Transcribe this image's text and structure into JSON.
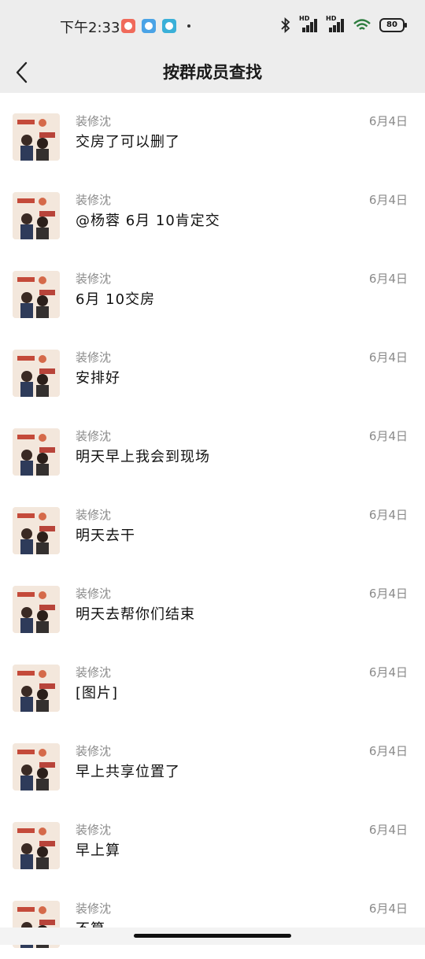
{
  "status_bar": {
    "time": "下午2:33",
    "battery": "80",
    "hd1": "HD",
    "hd2": "HD"
  },
  "header": {
    "title": "按群成员查找"
  },
  "results": [
    {
      "sender": "装修沈",
      "date": "6月4日",
      "message": "交房了可以删了"
    },
    {
      "sender": "装修沈",
      "date": "6月4日",
      "message": "@杨蓉 6月 10肯定交"
    },
    {
      "sender": "装修沈",
      "date": "6月4日",
      "message": "6月 10交房"
    },
    {
      "sender": "装修沈",
      "date": "6月4日",
      "message": "安排好"
    },
    {
      "sender": "装修沈",
      "date": "6月4日",
      "message": "明天早上我会到现场"
    },
    {
      "sender": "装修沈",
      "date": "6月4日",
      "message": "明天去干"
    },
    {
      "sender": "装修沈",
      "date": "6月4日",
      "message": "明天去帮你们结束"
    },
    {
      "sender": "装修沈",
      "date": "6月4日",
      "message": "[图片]"
    },
    {
      "sender": "装修沈",
      "date": "6月4日",
      "message": "早上共享位置了"
    },
    {
      "sender": "装修沈",
      "date": "6月4日",
      "message": "早上算"
    },
    {
      "sender": "装修沈",
      "date": "6月4日",
      "message": "不算"
    }
  ],
  "colors": {
    "header_bg": "#ededed",
    "secondary_text": "#8a8a8a"
  }
}
